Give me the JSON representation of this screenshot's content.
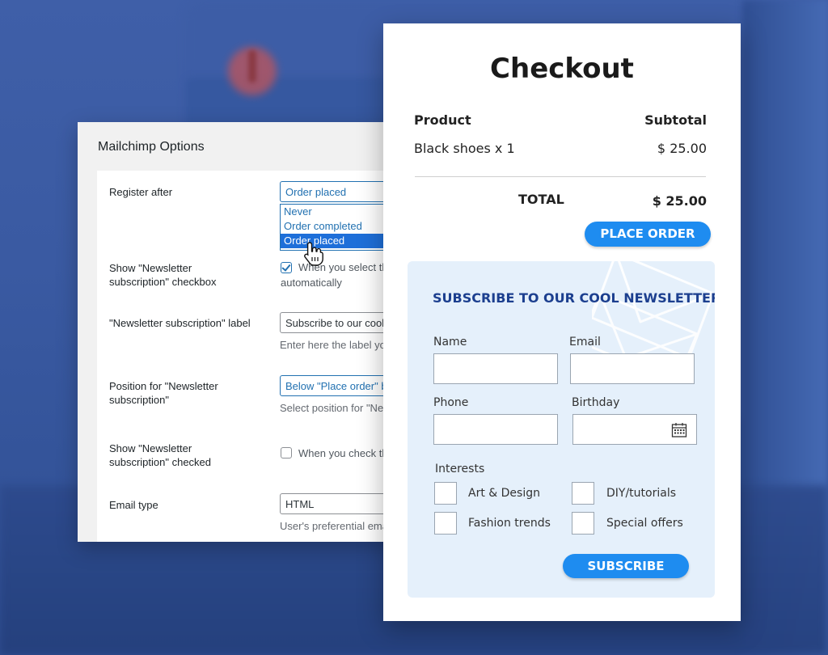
{
  "mailchimp": {
    "title": "Mailchimp Options",
    "register_after": {
      "label": "Register after",
      "value": "Order placed",
      "options": [
        "Never",
        "Order completed",
        "Order placed"
      ],
      "selected_option": "Order placed"
    },
    "show_checkbox": {
      "label": "Show \"Newsletter subscription\" checkbox",
      "checked": true,
      "text_line1": "When you select th",
      "text_line2": "automatically"
    },
    "subscription_label": {
      "label": "\"Newsletter subscription\" label",
      "value": "Subscribe to our cool",
      "description": "Enter here the label yo"
    },
    "position": {
      "label": "Position for \"Newsletter subscription\"",
      "value": "Below \"Place order\" b",
      "description": "Select position for \"Ne"
    },
    "checked_default": {
      "label": "Show \"Newsletter subscription\" checked",
      "checked": false,
      "text": "When you check th"
    },
    "email_type": {
      "label": "Email type",
      "value": "HTML",
      "description": "User's preferential ema"
    }
  },
  "checkout": {
    "title": "Checkout",
    "col_product": "Product",
    "col_subtotal": "Subtotal",
    "item_name": "Black shoes x 1",
    "item_price": "$  25.00",
    "total_label": "TOTAL",
    "total_value": "$  25.00",
    "place_order": "PLACE ORDER",
    "newsletter": {
      "title": "SUBSCRIBE TO OUR COOL NEWSLETTER",
      "name_label": "Name",
      "email_label": "Email",
      "phone_label": "Phone",
      "birthday_label": "Birthday",
      "interests_label": "Interests",
      "interests": [
        "Art & Design",
        "DIY/tutorials",
        "Fashion trends",
        "Special offers"
      ],
      "subscribe_button": "SUBSCRIBE"
    }
  },
  "colors": {
    "background": "#3a5aa2",
    "accent_button": "#1e8cf0",
    "newsletter_bg": "#e5f0fb",
    "newsletter_title": "#1c3f8f",
    "wp_blue": "#2271b1"
  }
}
